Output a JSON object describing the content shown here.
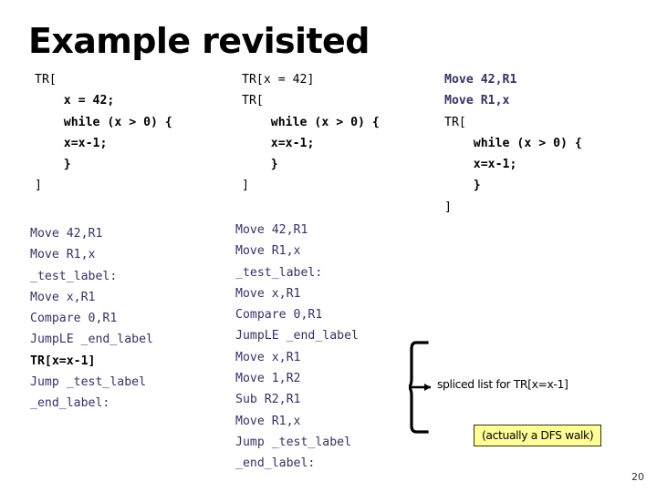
{
  "slide": {
    "title": "Example revisited",
    "page_number": "20",
    "background_color": "#ffffff"
  },
  "colors": {
    "code_black": "#000000",
    "assembly_navy": "#333366",
    "callout_background": "#ffff99",
    "callout_border": "#333300"
  },
  "code_columns": [
    {
      "id": "col1-top",
      "name": "original-source-block",
      "lines": [
        {
          "text": "TR[",
          "weight": "normal",
          "color": "black",
          "indent": 0
        },
        {
          "text": "x = 42;",
          "weight": "bold",
          "color": "black",
          "indent": 2
        },
        {
          "text": "while (x > 0) {",
          "weight": "bold",
          "color": "black",
          "indent": 2
        },
        {
          "text": "x=x-1;",
          "weight": "bold",
          "color": "black",
          "indent": 2
        },
        {
          "text": "}",
          "weight": "bold",
          "color": "black",
          "indent": 2
        },
        {
          "text": "]",
          "weight": "normal",
          "color": "black",
          "indent": 0
        }
      ]
    },
    {
      "id": "col2-top",
      "name": "first-expansion-block",
      "lines": [
        {
          "text": "TR[x = 42]",
          "weight": "normal",
          "color": "black",
          "indent": 0
        },
        {
          "text": "TR[",
          "weight": "normal",
          "color": "black",
          "indent": 0
        },
        {
          "text": "while (x > 0) {",
          "weight": "bold",
          "color": "black",
          "indent": 2
        },
        {
          "text": "x=x-1;",
          "weight": "bold",
          "color": "black",
          "indent": 2
        },
        {
          "text": "}",
          "weight": "bold",
          "color": "black",
          "indent": 2
        },
        {
          "text": "]",
          "weight": "normal",
          "color": "black",
          "indent": 0
        }
      ]
    },
    {
      "id": "col3-top",
      "name": "second-expansion-block",
      "lines": [
        {
          "text": "Move 42,R1",
          "weight": "bold",
          "color": "navy",
          "indent": 0
        },
        {
          "text": "Move R1,x",
          "weight": "bold",
          "color": "navy",
          "indent": 0
        },
        {
          "text": "TR[",
          "weight": "normal",
          "color": "black",
          "indent": 0
        },
        {
          "text": "while (x > 0) {",
          "weight": "bold",
          "color": "black",
          "indent": 2
        },
        {
          "text": "x=x-1;",
          "weight": "bold",
          "color": "black",
          "indent": 2
        },
        {
          "text": "}",
          "weight": "bold",
          "color": "black",
          "indent": 2
        },
        {
          "text": "]",
          "weight": "normal",
          "color": "black",
          "indent": 0
        }
      ]
    },
    {
      "id": "col1-asm",
      "name": "assembly-with-nested-tr-block",
      "lines": [
        {
          "text": "Move 42,R1",
          "weight": "normal",
          "color": "navy",
          "indent": 0
        },
        {
          "text": "Move R1,x",
          "weight": "normal",
          "color": "navy",
          "indent": 0
        },
        {
          "text": "_test_label:",
          "weight": "normal",
          "color": "navy",
          "indent": 0
        },
        {
          "text": "Move x,R1",
          "weight": "normal",
          "color": "navy",
          "indent": 0
        },
        {
          "text": "Compare 0,R1",
          "weight": "normal",
          "color": "navy",
          "indent": 0
        },
        {
          "text": "JumpLE _end_label",
          "weight": "normal",
          "color": "navy",
          "indent": 0
        },
        {
          "text": "TR[x=x-1]",
          "weight": "bold",
          "color": "black",
          "indent": 0
        },
        {
          "text": "Jump _test_label",
          "weight": "normal",
          "color": "navy",
          "indent": 0
        },
        {
          "text": "_end_label:",
          "weight": "normal",
          "color": "navy",
          "indent": 0
        }
      ]
    },
    {
      "id": "col2-asm",
      "name": "fully-spliced-assembly-block",
      "lines": [
        {
          "text": "Move 42,R1",
          "weight": "normal",
          "color": "navy",
          "indent": 0
        },
        {
          "text": "Move R1,x",
          "weight": "normal",
          "color": "navy",
          "indent": 0
        },
        {
          "text": "_test_label:",
          "weight": "normal",
          "color": "navy",
          "indent": 0
        },
        {
          "text": "Move x,R1",
          "weight": "normal",
          "color": "navy",
          "indent": 0
        },
        {
          "text": "Compare 0,R1",
          "weight": "normal",
          "color": "navy",
          "indent": 0
        },
        {
          "text": "JumpLE _end_label",
          "weight": "normal",
          "color": "navy",
          "indent": 0
        },
        {
          "text": "Move x,R1",
          "weight": "normal",
          "color": "navy",
          "indent": 0
        },
        {
          "text": "Move 1,R2",
          "weight": "normal",
          "color": "navy",
          "indent": 0
        },
        {
          "text": "Sub R2,R1",
          "weight": "normal",
          "color": "navy",
          "indent": 0
        },
        {
          "text": "Move R1,x",
          "weight": "normal",
          "color": "navy",
          "indent": 0
        },
        {
          "text": "Jump _test_label",
          "weight": "normal",
          "color": "navy",
          "indent": 0
        },
        {
          "text": "_end_label:",
          "weight": "normal",
          "color": "navy",
          "indent": 0
        }
      ]
    }
  ],
  "annotations": {
    "spliced_label": "spliced list for TR[x=x-1]",
    "dfs_note": "(actually a DFS walk)"
  }
}
